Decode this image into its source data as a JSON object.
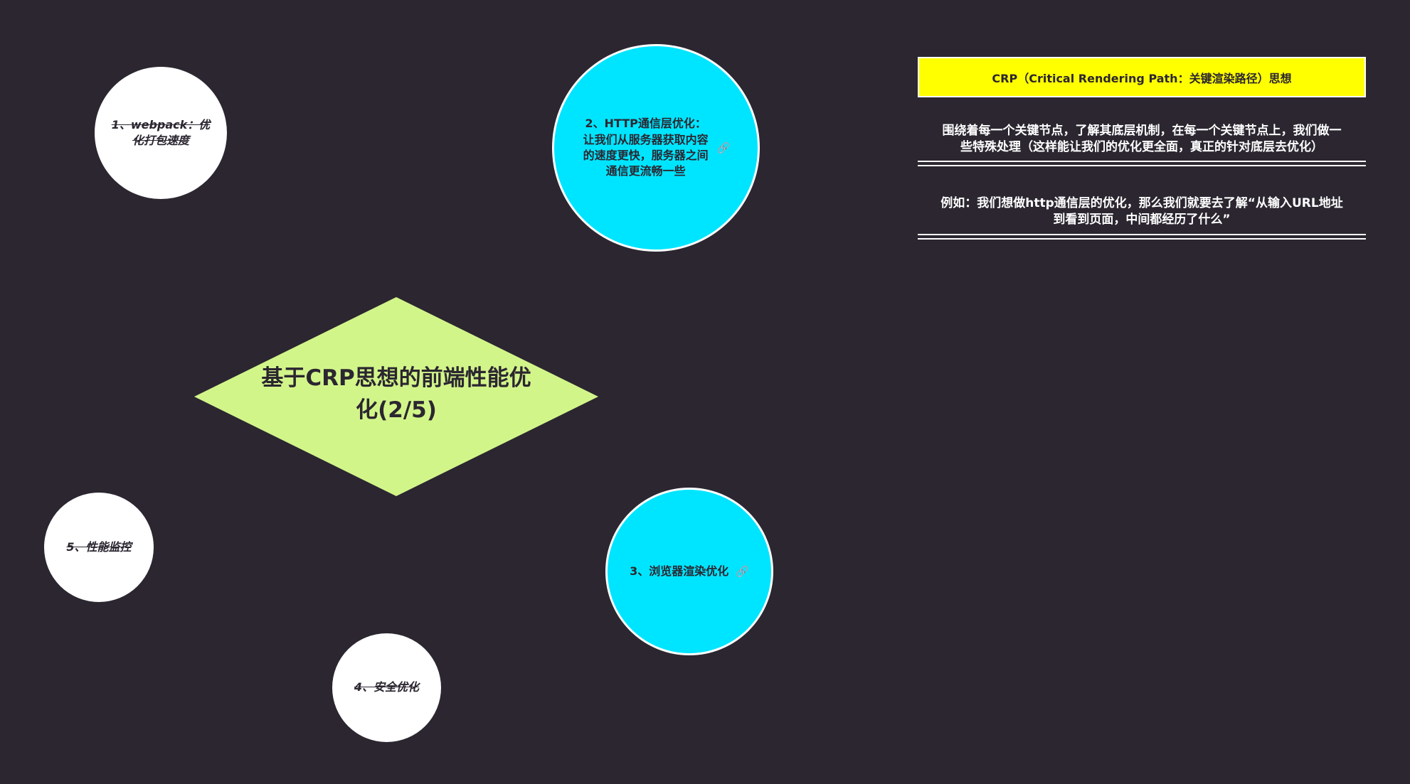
{
  "diagram": {
    "center_title": "基于CRP思想的前端性能优化(2/5)",
    "branches": [
      {
        "id": "webpack",
        "text": "1、webpack：优化打包速度",
        "struck": true
      },
      {
        "id": "http",
        "text": "2、HTTP通信层优化：让我们从服务器获取内容的速度更快，服务器之间通信更流畅一些",
        "has_link": true
      },
      {
        "id": "render",
        "text": "3、浏览器渲染优化",
        "has_link": true
      },
      {
        "id": "security",
        "text": "4、安全优化",
        "struck": true
      },
      {
        "id": "monitor",
        "text": "5、性能监控",
        "struck": true
      }
    ],
    "link_icon": "link-icon"
  },
  "crp_panel": {
    "title": "CRP（Critical Rendering Path：关键渲染路径）思想",
    "paragraph_1": "围绕着每一个关键节点，了解其底层机制，在每一个关键节点上，我们做一些特殊处理（这样能让我们的优化更全面，真正的针对底层去优化）",
    "paragraph_2": "例如：我们想做http通信层的优化，那么我们就要去了解“从输入URL地址到看到页面，中间都经历了什么”"
  },
  "colors": {
    "background": "#2b2630",
    "diamond": "#d2f58a",
    "cyan_node": "#00e5ff",
    "highlight": "#ffff00"
  }
}
